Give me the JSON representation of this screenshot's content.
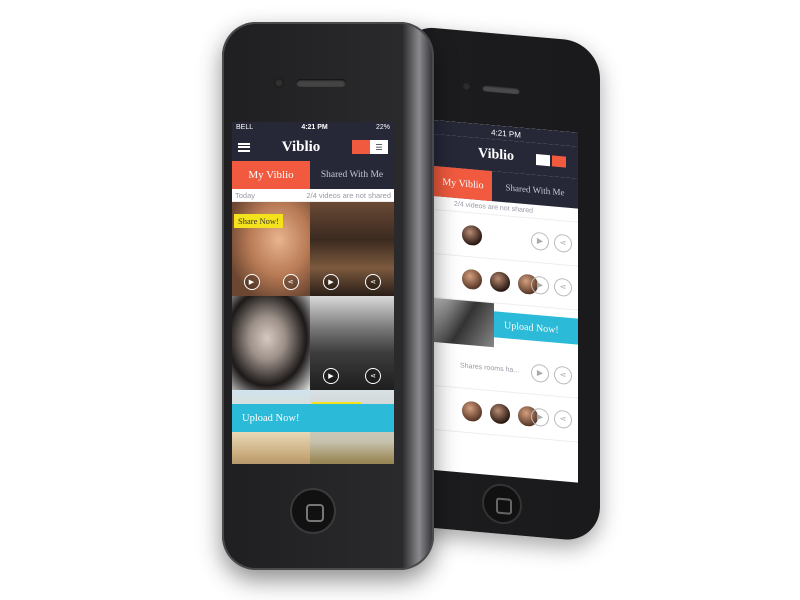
{
  "back_phone": {
    "status_time": "4:21 PM",
    "title": "Viblio",
    "tab_active": "My Viblio",
    "tab_inactive": "Shared With Me",
    "sub_text": "2/4 videos are not shared",
    "upload_label": "Upload Now!",
    "muted_text": "Shares rooms ha..."
  },
  "front_phone": {
    "status": {
      "carrier": "BELL",
      "time": "4:21 PM",
      "battery": "22%"
    },
    "title": "Viblio",
    "tabs": {
      "active": "My Viblio",
      "inactive": "Shared With Me"
    },
    "subbar": {
      "left": "Today",
      "right": "2/4 videos are not shared"
    },
    "share_badge": "Share Now!",
    "upload_label": "Upload Now!"
  },
  "icons": [
    "menu-icon",
    "grid-view-icon",
    "list-view-icon",
    "play-icon",
    "share-icon",
    "home-button-icon"
  ],
  "colors": {
    "accent": "#f15a3f",
    "navbar": "#262838",
    "upload": "#2bbbd8",
    "badge": "#f4e21c"
  }
}
